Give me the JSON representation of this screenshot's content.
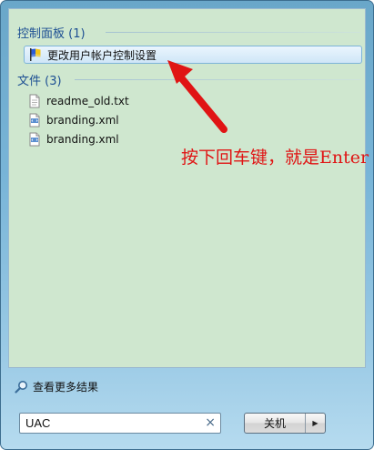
{
  "results": {
    "groups": [
      {
        "header": "控制面板 (1)",
        "items": [
          {
            "label": "更改用户帐户控制设置",
            "icon": "uac-flag-icon",
            "selected": true
          }
        ]
      },
      {
        "header": "文件 (3)",
        "items": [
          {
            "label": "readme_old.txt",
            "icon": "text-file-icon"
          },
          {
            "label": "branding.xml",
            "icon": "xml-file-icon"
          },
          {
            "label": "branding.xml",
            "icon": "xml-file-icon"
          }
        ]
      }
    ]
  },
  "annotation": {
    "text": "按下回车键，就是Enter",
    "color": "#e01414"
  },
  "footer": {
    "see_more": "查看更多结果",
    "search_value": "UAC",
    "clear_glyph": "×",
    "shutdown_label": "关机",
    "shutdown_arrow_glyph": "▶"
  },
  "colors": {
    "results_bg": "#cfe7cf",
    "header_text": "#1d4f93",
    "frame_accent": "#79b5d8"
  }
}
